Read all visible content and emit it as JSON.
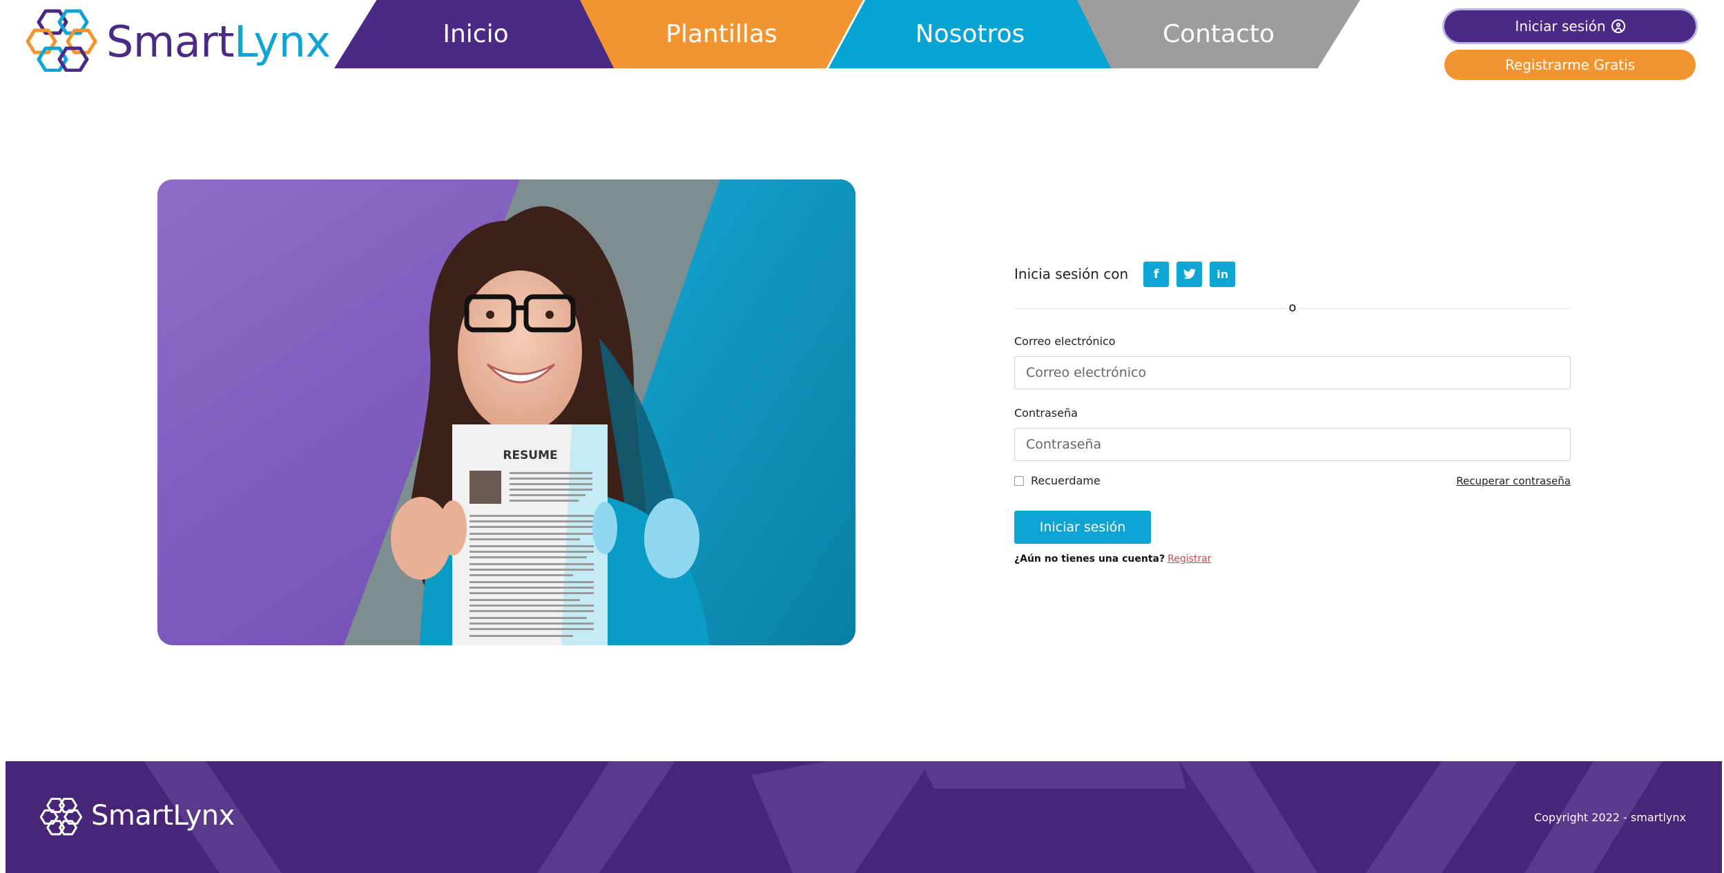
{
  "brand": {
    "smart": "Smart",
    "lynx": "Lynx",
    "colors": {
      "purple": "#4b2a85",
      "orange": "#f29430",
      "cyan": "#05a4d3",
      "gray": "#9d9d9d"
    }
  },
  "nav": {
    "items": [
      {
        "label": "Inicio"
      },
      {
        "label": "Plantillas"
      },
      {
        "label": "Nosotros"
      },
      {
        "label": "Contacto"
      }
    ]
  },
  "header_actions": {
    "login_label": "Iniciar sesión",
    "login_icon": "user-circle-icon",
    "register_label": "Registrarme Gratis"
  },
  "hero": {
    "resume_heading": "RESUME"
  },
  "login": {
    "social_label": "Inicia sesión con",
    "social": [
      {
        "icon": "facebook-icon",
        "glyph": "f"
      },
      {
        "icon": "twitter-icon",
        "glyph": "t"
      },
      {
        "icon": "linkedin-icon",
        "glyph": "in"
      }
    ],
    "divider_text": "o",
    "email_label": "Correo electrónico",
    "email_placeholder": "Correo electrónico",
    "email_value": "",
    "password_label": "Contraseña",
    "password_placeholder": "Contraseña",
    "password_value": "",
    "remember_label": "Recuerdame",
    "remember_checked": false,
    "recover_label": "Recuperar contraseña",
    "submit_label": "Iniciar sesión",
    "signup_prompt": "¿Aún no tienes una cuenta?",
    "signup_link": "Registrar"
  },
  "footer": {
    "brand": "SmartLynx",
    "copyright": "Copyright 2022 - smartlynx",
    "background": "#472677"
  }
}
